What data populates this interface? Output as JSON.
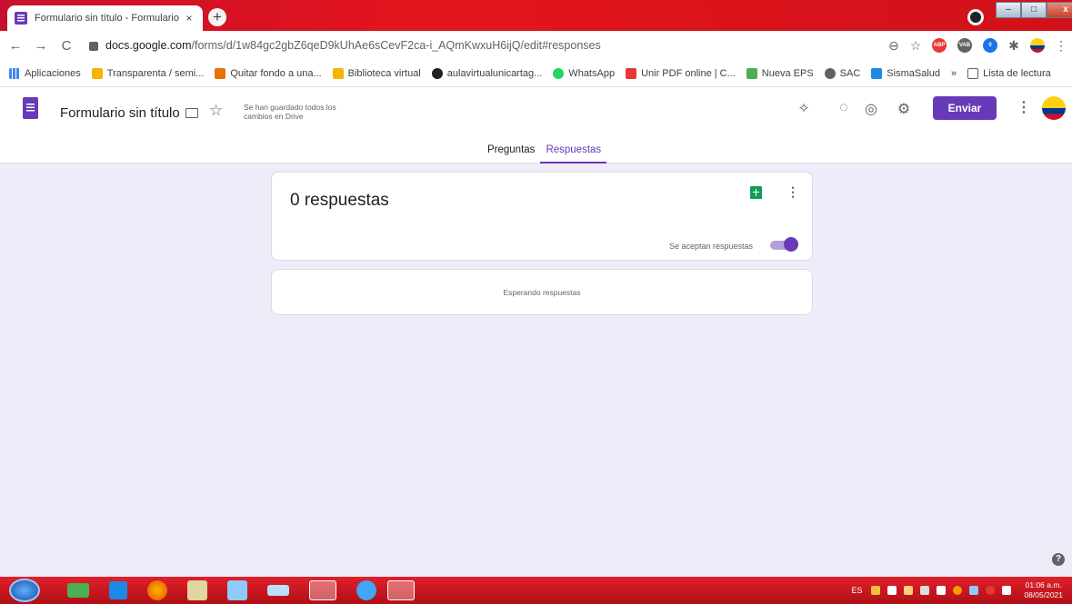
{
  "browser": {
    "tab_title": "Formulario sin título - Formulario",
    "tab_close": "×",
    "new_tab": "+",
    "url_host": "docs.google.com",
    "url_path": "/forms/d/1w84gc2gbZ6qeD9kUhAe6sCevF2ca-i_AQmKwxuH6ijQ/edit#responses",
    "back": "←",
    "forward": "→",
    "reload": "C",
    "zoom": "⊖",
    "star": "☆",
    "more": "⋮"
  },
  "bookmarks": {
    "apps_label": "Aplicaciones",
    "items": [
      {
        "label": "Transparenta / semi...",
        "color": "#f4b400"
      },
      {
        "label": "Quitar fondo a una...",
        "color": "#e8710a"
      },
      {
        "label": "Biblioteca virtual",
        "color": "#f4b400"
      },
      {
        "label": "aulavirtualunicartag...",
        "color": "#202124"
      },
      {
        "label": "WhatsApp",
        "color": "#25d366"
      },
      {
        "label": "Unir PDF online | C...",
        "color": "#e53935"
      },
      {
        "label": "Nueva EPS",
        "color": "#4caf50"
      },
      {
        "label": "SAC",
        "color": "#5f6368"
      },
      {
        "label": "SismaSalud",
        "color": "#1e88e5"
      }
    ],
    "overflow": "»",
    "reading_list": "Lista de lectura"
  },
  "form_header": {
    "title": "Formulario sin título",
    "saved_status": "Se han guardado todos los cambios en Drive",
    "send_label": "Enviar",
    "tabs": [
      "Preguntas",
      "Respuestas"
    ],
    "active_tab": "Respuestas"
  },
  "responses": {
    "count_label": "0 respuestas",
    "accepting_label": "Se aceptan respuestas",
    "accepting": true,
    "waiting_label": "Esperando respuestas"
  },
  "taskbar": {
    "language": "ES",
    "time": "01:06 a.m.",
    "date": "08/05/2021"
  },
  "colors": {
    "accent": "#673ab7",
    "background": "#f0ebf8",
    "sheets": "#0f9d58"
  }
}
